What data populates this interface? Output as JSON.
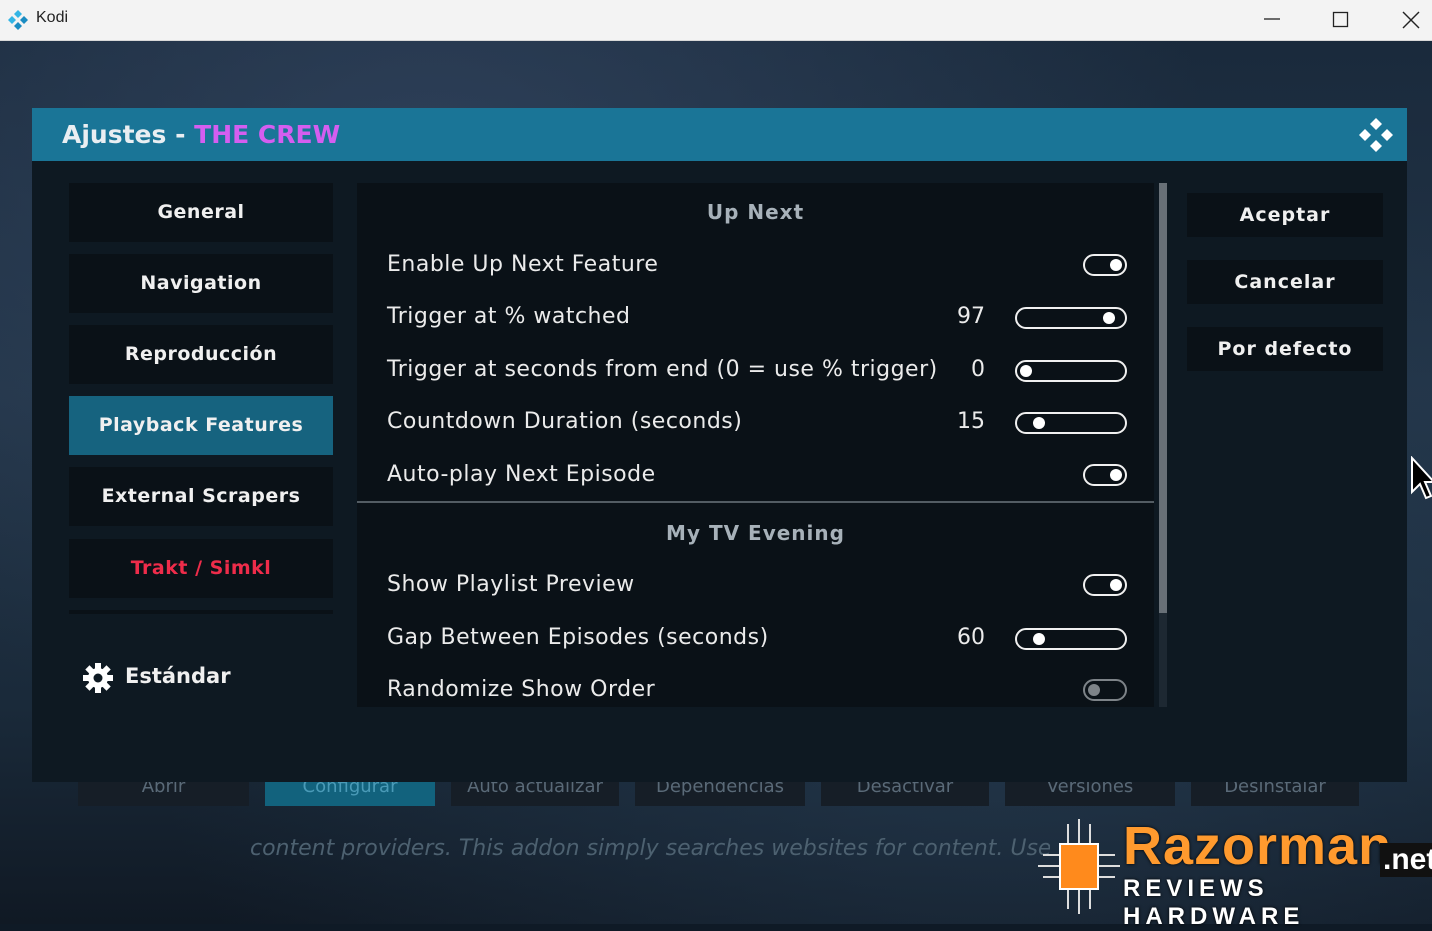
{
  "window": {
    "title": "Kodi",
    "icon": "kodi-logo-icon",
    "controls": [
      "minimize-icon",
      "maximize-icon",
      "close-icon"
    ]
  },
  "background": {
    "buttons": [
      {
        "label": "Abrir",
        "active": false
      },
      {
        "label": "Configurar",
        "active": true
      },
      {
        "label": "Auto actualizar",
        "active": false
      },
      {
        "label": "Dependencias",
        "active": false
      },
      {
        "label": "Desactivar",
        "active": false
      },
      {
        "label": "Versiones",
        "active": false
      },
      {
        "label": "Desinstalar",
        "active": false
      }
    ],
    "description": "content providers. This addon simply searches websites for content. Use it at your own risk"
  },
  "dialog": {
    "title_prefix": "Ajustes - ",
    "addon_name": "THE CREW",
    "addon_name_color": "#d45ef0",
    "header_color": "#1a7597",
    "categories": [
      {
        "label": "General",
        "selected": false
      },
      {
        "label": "Navigation",
        "selected": false
      },
      {
        "label": "Reproducción",
        "selected": false
      },
      {
        "label": "Playback Features",
        "selected": true
      },
      {
        "label": "External Scrapers",
        "selected": false
      },
      {
        "label": "Trakt / Simkl",
        "selected": false,
        "color": "#ee2c4a"
      }
    ],
    "level": {
      "icon": "gear-icon",
      "label": "Estándar"
    },
    "groups": [
      {
        "title": "Up Next",
        "settings": [
          {
            "label": "Enable Up Next Feature",
            "type": "toggle",
            "on": true
          },
          {
            "label": "Trigger at % watched",
            "type": "slider",
            "value": "97",
            "fraction": 0.97
          },
          {
            "label": "Trigger at seconds from end (0 = use % trigger)",
            "type": "slider",
            "value": "0",
            "fraction": 0.0
          },
          {
            "label": "Countdown Duration (seconds)",
            "type": "slider",
            "value": "15",
            "fraction": 0.15
          },
          {
            "label": "Auto-play Next Episode",
            "type": "toggle",
            "on": true
          }
        ]
      },
      {
        "title": "My TV Evening",
        "settings": [
          {
            "label": "Show Playlist Preview",
            "type": "toggle",
            "on": true
          },
          {
            "label": "Gap Between Episodes (seconds)",
            "type": "slider",
            "value": "60",
            "fraction": 0.15
          },
          {
            "label": "Randomize Show Order",
            "type": "toggle",
            "on": false
          }
        ]
      }
    ],
    "actions": [
      "Aceptar",
      "Cancelar",
      "Por defecto"
    ],
    "close_icon": "kodi-close-icon"
  },
  "watermark": {
    "name": "Razorman",
    "tld": ".net",
    "tagline": "REVIEWS HARDWARE"
  }
}
